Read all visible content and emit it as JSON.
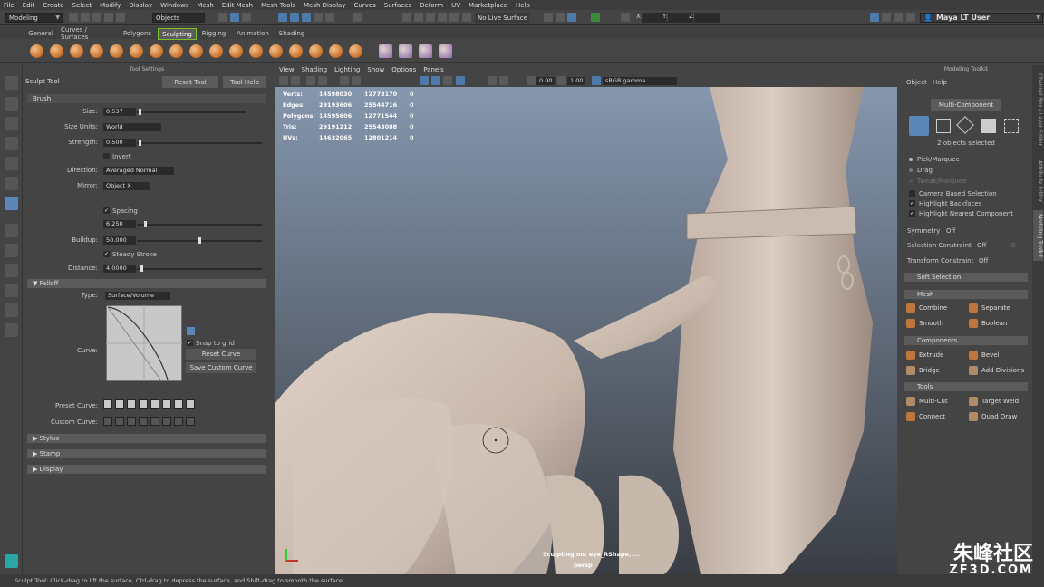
{
  "menus": [
    "File",
    "Edit",
    "Create",
    "Select",
    "Modify",
    "Display",
    "Windows",
    "Mesh",
    "Edit Mesh",
    "Mesh Tools",
    "Mesh Display",
    "Curves",
    "Surfaces",
    "Deform",
    "UV",
    "Marketplace",
    "Help"
  ],
  "status_line": {
    "menu_set": "Modeling",
    "selection_mode": "Objects",
    "live_surface": "No Live Surface",
    "x_label": "X:",
    "y_label": "Y:",
    "z_label": "Z:",
    "user": "Maya LT User"
  },
  "shelf_tabs": [
    "General",
    "Curves / Surfaces",
    "Polygons",
    "Sculpting",
    "Rigging",
    "Animation",
    "Shading"
  ],
  "active_shelf_tab": "Sculpting",
  "tool_settings": {
    "panel_title": "Tool Settings",
    "tool_name": "Sculpt Tool",
    "reset_button": "Reset Tool",
    "help_button": "Tool Help",
    "brush_section": "Brush",
    "size_label": "Size:",
    "size_value": "0.537",
    "size_units_label": "Size Units:",
    "size_units_value": "World",
    "strength_label": "Strength:",
    "strength_value": "0.500",
    "invert_label": "Invert",
    "direction_label": "Direction:",
    "direction_value": "Averaged Normal",
    "mirror_label": "Mirror:",
    "mirror_value": "Object X",
    "spacing_label": "Spacing",
    "spacing_value": "6.250",
    "buildup_label": "Buildup:",
    "buildup_value": "50.000",
    "steady_stroke_label": "Steady Stroke",
    "distance_label": "Distance:",
    "distance_value": "4.0000",
    "falloff_section": "Falloff",
    "type_label": "Type:",
    "type_value": "Surface/Volume",
    "curve_label": "Curve:",
    "snap_to_grid_label": "Snap to grid",
    "reset_curve_button": "Reset Curve",
    "save_curve_button": "Save Custom Curve",
    "preset_curve_label": "Preset Curve:",
    "custom_curve_label": "Custom Curve:",
    "stylus_section": "Stylus",
    "stamp_section": "Stamp",
    "display_section": "Display"
  },
  "viewport": {
    "menus": [
      "View",
      "Shading",
      "Lighting",
      "Show",
      "Options",
      "Panels"
    ],
    "near_value": "0.00",
    "far_value": "1.00",
    "color_space": "sRGB gamma",
    "stats": [
      {
        "label": "Verts:",
        "a": "14598030",
        "b": "12773170",
        "c": "0"
      },
      {
        "label": "Edges:",
        "a": "29193606",
        "b": "25544716",
        "c": "0"
      },
      {
        "label": "Polygons:",
        "a": "14595606",
        "b": "12771544",
        "c": "0"
      },
      {
        "label": "Tris:",
        "a": "29191212",
        "b": "25543088",
        "c": "0"
      },
      {
        "label": "UVs:",
        "a": "14632065",
        "b": "12801214",
        "c": "0"
      }
    ],
    "sculpt_status": "Sculpting on: eye_RShape, ...",
    "camera": "persp"
  },
  "modeling_toolkit": {
    "title": "Modeling Toolkit",
    "menu_object": "Object",
    "menu_help": "Help",
    "mode_button": "Multi-Component",
    "selection_info": "2 objects selected",
    "pick_marquee": "Pick/Marquee",
    "drag": "Drag",
    "tweak_marquee": "Tweak/Marquee",
    "camera_based": "Camera Based Selection",
    "highlight_backfaces": "Highlight Backfaces",
    "highlight_nearest": "Highlight Nearest Component",
    "symmetry_label": "Symmetry",
    "symmetry_value": "Off",
    "sel_constraint_label": "Selection Constraint",
    "sel_constraint_value": "Off",
    "sel_constraint_num": "0",
    "transform_constraint_label": "Transform Constraint",
    "transform_constraint_value": "Off",
    "soft_selection": "Soft Selection",
    "mesh_section": "Mesh",
    "combine": "Combine",
    "separate": "Separate",
    "smooth": "Smooth",
    "boolean": "Boolean",
    "components_section": "Components",
    "extrude": "Extrude",
    "bevel": "Bevel",
    "bridge": "Bridge",
    "add_divisions": "Add Divisions",
    "tools_section": "Tools",
    "multi_cut": "Multi-Cut",
    "target_weld": "Target Weld",
    "connect": "Connect",
    "quad_draw": "Quad Draw"
  },
  "side_tabs": [
    "Channel Box / Layer Editor",
    "Attribute Editor",
    "Modeling Toolkit"
  ],
  "help_line": "Sculpt Tool: Click-drag to lift the surface, Ctrl-drag to depress the surface, and Shift-drag to smooth the surface.",
  "watermark": {
    "main": "朱峰社区",
    "sub": "ZF3D.COM"
  },
  "colors": {
    "accent_blue": "#5a87b8",
    "shelf_active_border": "#7fbf2e",
    "model_clay": "#cbbdb2"
  }
}
